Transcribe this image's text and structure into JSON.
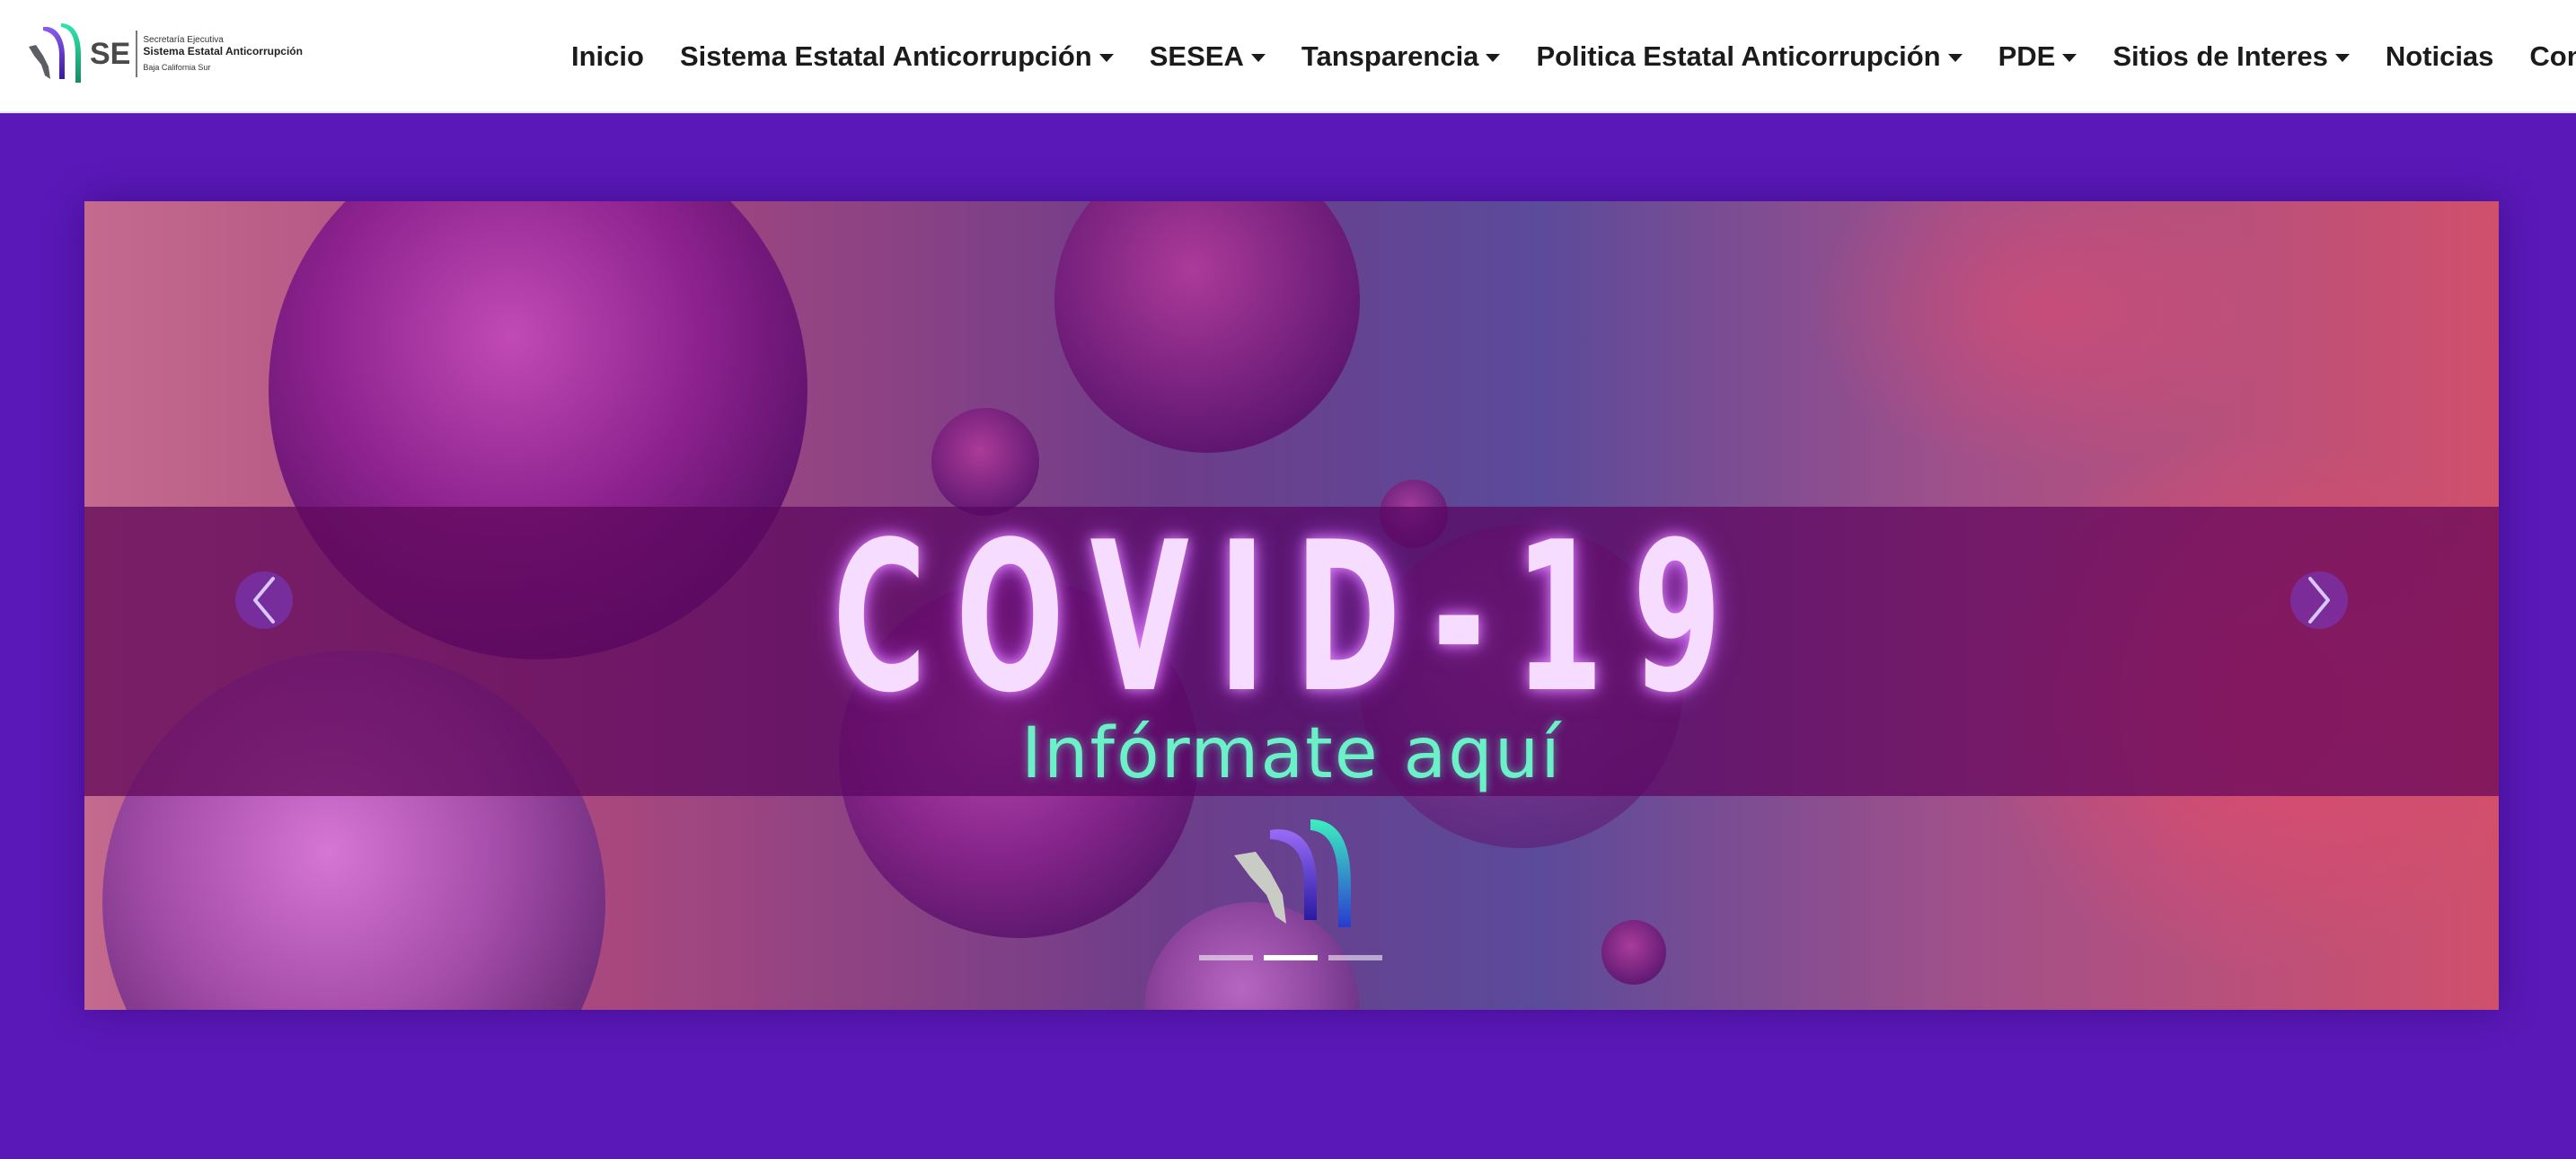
{
  "header": {
    "logo": {
      "short": "SE",
      "line1": "Secretaría Ejecutiva",
      "line2": "Sistema Estatal Anticorrupción",
      "line3": "Baja California Sur"
    },
    "nav": [
      {
        "label": "Inicio",
        "dropdown": false
      },
      {
        "label": "Sistema Estatal Anticorrupción",
        "dropdown": true
      },
      {
        "label": "SESEA",
        "dropdown": true
      },
      {
        "label": "Tansparencia",
        "dropdown": true
      },
      {
        "label": "Politica Estatal Anticorrupción",
        "dropdown": true
      },
      {
        "label": "PDE",
        "dropdown": true
      },
      {
        "label": "Sitios de Interes",
        "dropdown": true
      },
      {
        "label": "Noticias",
        "dropdown": false
      },
      {
        "label": "Contacto",
        "dropdown": false
      }
    ]
  },
  "carousel": {
    "title": "COVID-19",
    "subtitle": "Infórmate aquí",
    "active_slide": 2,
    "slide_count": 3,
    "icons": {
      "prev": "chevron-left-icon",
      "next": "chevron-right-icon"
    }
  },
  "colors": {
    "page_bg": "#5a18b8",
    "nav_bg": "#ffffff",
    "title_glow": "#f6dcff",
    "subtitle": "#6cf0c8",
    "band": "#6a0a64"
  }
}
